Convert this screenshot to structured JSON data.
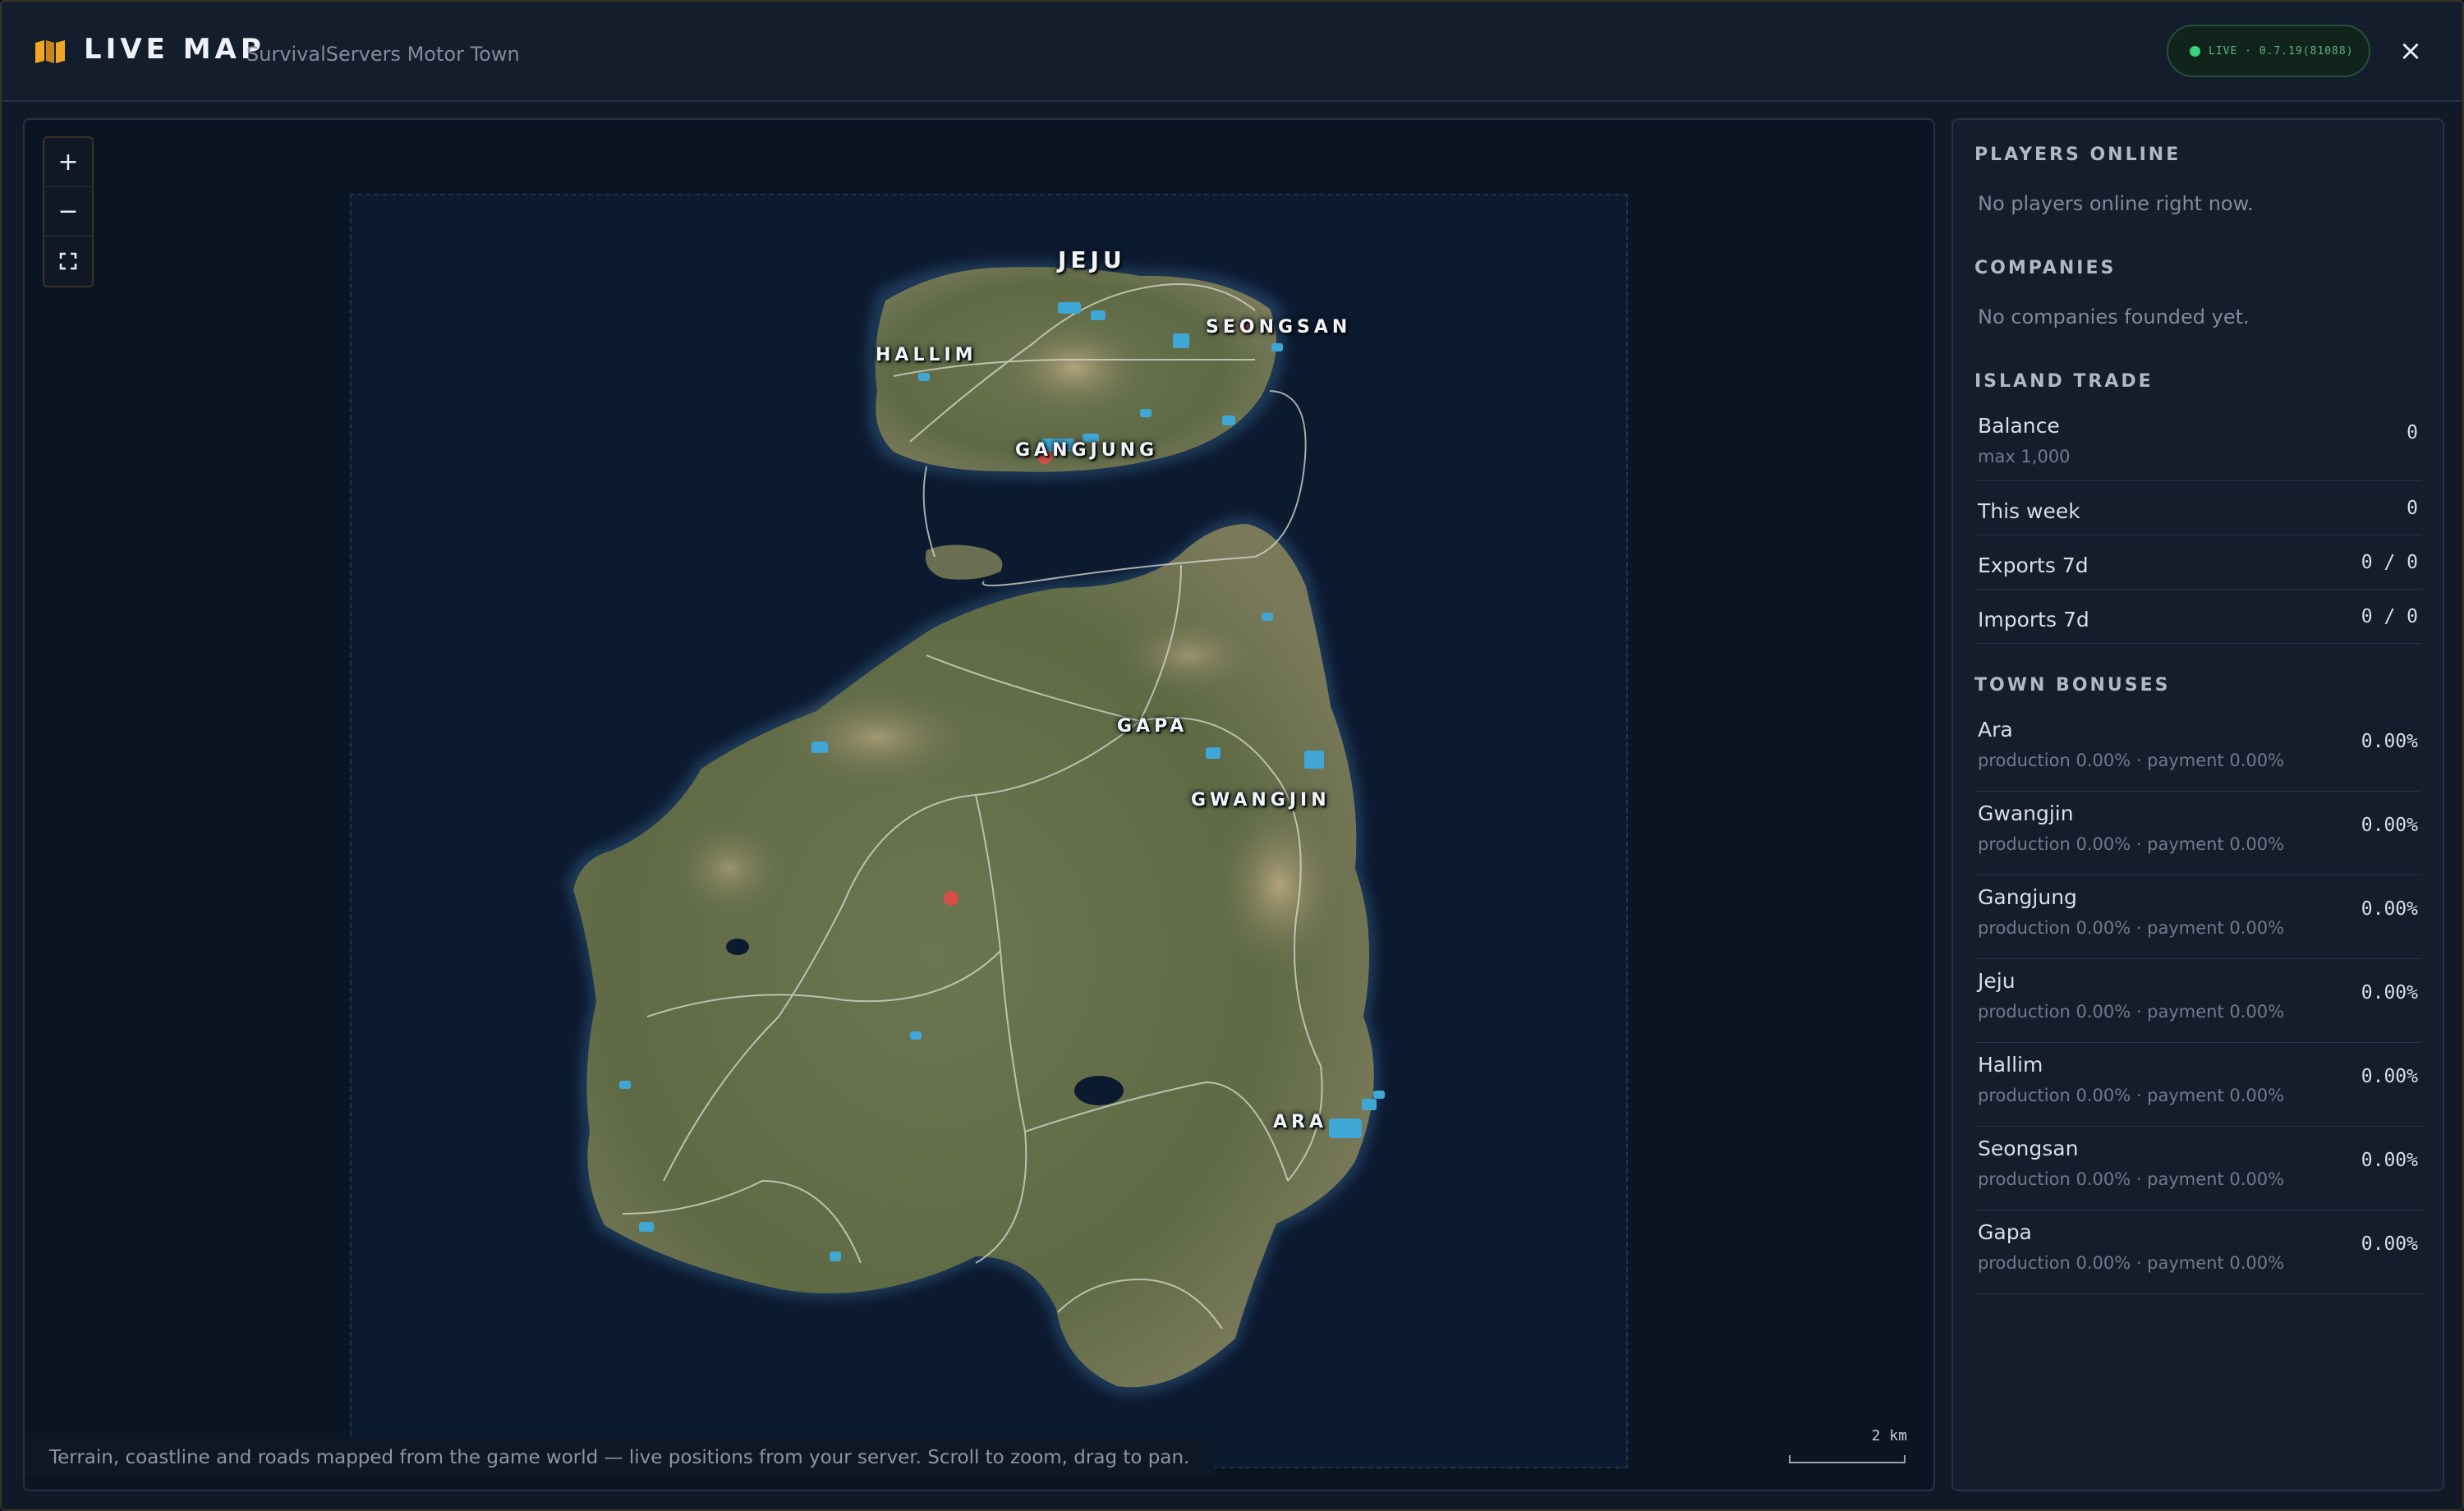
{
  "header": {
    "title": "LIVE MAP",
    "subtitle": "SurvivalServers Motor Town",
    "live_status": "LIVE · 0.7.19(81088)",
    "close_label": "×"
  },
  "map": {
    "zoom_in_label": "+",
    "zoom_out_label": "−",
    "fullscreen_label": "⛶",
    "attribution": "Terrain, coastline and roads mapped from the game world — live positions from your server. Scroll to zoom, drag to pan.",
    "scale_label": "2 km",
    "towns": [
      "JEJU",
      "SEONGSAN",
      "HALLIM",
      "GANGJUNG",
      "GAPA",
      "GWANGJIN",
      "ARA"
    ]
  },
  "sidebar": {
    "players": {
      "title": "PLAYERS ONLINE",
      "empty": "No players online right now."
    },
    "companies": {
      "title": "COMPANIES",
      "empty": "No companies founded yet."
    },
    "trade": {
      "title": "ISLAND TRADE",
      "rows": [
        {
          "label": "Balance",
          "sub": "max 1,000",
          "value": "0"
        },
        {
          "label": "This week",
          "value": "0"
        },
        {
          "label": "Exports 7d",
          "value": "0 / 0"
        },
        {
          "label": "Imports 7d",
          "value": "0 / 0"
        }
      ]
    },
    "bonuses": {
      "title": "TOWN BONUSES",
      "rows": [
        {
          "label": "Ara",
          "sub": "production 0.00% · payment 0.00%",
          "value": "0.00%"
        },
        {
          "label": "Gwangjin",
          "sub": "production 0.00% · payment 0.00%",
          "value": "0.00%"
        },
        {
          "label": "Gangjung",
          "sub": "production 0.00% · payment 0.00%",
          "value": "0.00%"
        },
        {
          "label": "Jeju",
          "sub": "production 0.00% · payment 0.00%",
          "value": "0.00%"
        },
        {
          "label": "Hallim",
          "sub": "production 0.00% · payment 0.00%",
          "value": "0.00%"
        },
        {
          "label": "Seongsan",
          "sub": "production 0.00% · payment 0.00%",
          "value": "0.00%"
        },
        {
          "label": "Gapa",
          "sub": "production 0.00% · payment 0.00%",
          "value": "0.00%"
        }
      ]
    }
  },
  "colors": {
    "accent": "#f0a623",
    "live": "#38d27a",
    "water": "#0c1a30",
    "land": "#5f6b45",
    "marker": "#e24a4a",
    "town_lots": "#3fa7d6"
  }
}
